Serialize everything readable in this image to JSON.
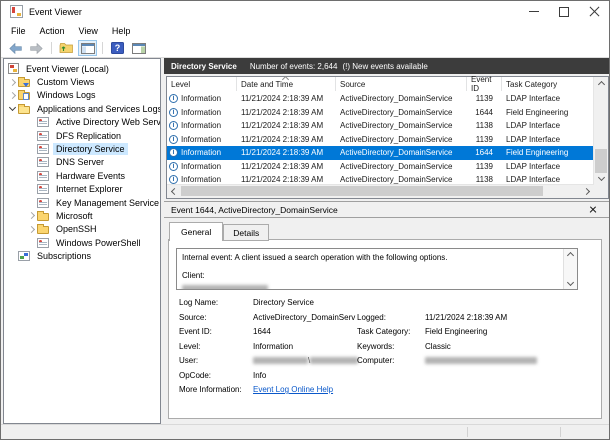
{
  "window": {
    "title": "Event Viewer"
  },
  "menu": {
    "items": [
      "File",
      "Action",
      "View",
      "Help"
    ]
  },
  "toolbar": {
    "icons": [
      "back-icon",
      "forward-icon",
      "up-one-level-icon",
      "show-hide-console-tree-icon",
      "help-icon",
      "show-hide-action-pane-icon"
    ]
  },
  "tree": {
    "items": [
      {
        "label": "Event Viewer (Local)",
        "level": 0,
        "icon": "event-viewer",
        "expander": ""
      },
      {
        "label": "Custom Views",
        "level": 1,
        "icon": "custom-views",
        "expander": ">"
      },
      {
        "label": "Windows Logs",
        "level": 1,
        "icon": "windows-logs",
        "expander": ">"
      },
      {
        "label": "Applications and Services Logs",
        "level": 1,
        "icon": "folder-open",
        "expander": "v"
      },
      {
        "label": "Active Directory Web Services",
        "level": 2,
        "icon": "event-log",
        "expander": ""
      },
      {
        "label": "DFS Replication",
        "level": 2,
        "icon": "event-log",
        "expander": ""
      },
      {
        "label": "Directory Service",
        "level": 2,
        "icon": "event-log",
        "expander": "",
        "selected": true
      },
      {
        "label": "DNS Server",
        "level": 2,
        "icon": "event-log",
        "expander": ""
      },
      {
        "label": "Hardware Events",
        "level": 2,
        "icon": "event-log",
        "expander": ""
      },
      {
        "label": "Internet Explorer",
        "level": 2,
        "icon": "event-log",
        "expander": ""
      },
      {
        "label": "Key Management Service",
        "level": 2,
        "icon": "event-log",
        "expander": ""
      },
      {
        "label": "Microsoft",
        "level": 2,
        "icon": "folder",
        "expander": ">"
      },
      {
        "label": "OpenSSH",
        "level": 2,
        "icon": "folder",
        "expander": ">"
      },
      {
        "label": "Windows PowerShell",
        "level": 2,
        "icon": "event-log",
        "expander": ""
      },
      {
        "label": "Subscriptions",
        "level": 1,
        "icon": "subscriptions",
        "expander": ""
      }
    ]
  },
  "header": {
    "title": "Directory Service",
    "count_text": "Number of events: 2,644",
    "new_events_text": "(!) New events available"
  },
  "events_table": {
    "columns": [
      "Level",
      "Date and Time",
      "Source",
      "Event ID",
      "Task Category"
    ],
    "sorted_column": "Date and Time",
    "rows": [
      {
        "level": "Information",
        "datetime": "11/21/2024 2:18:39 AM",
        "source": "ActiveDirectory_DomainService",
        "event_id": "1139",
        "task_category": "LDAP Interface"
      },
      {
        "level": "Information",
        "datetime": "11/21/2024 2:18:39 AM",
        "source": "ActiveDirectory_DomainService",
        "event_id": "1644",
        "task_category": "Field Engineering"
      },
      {
        "level": "Information",
        "datetime": "11/21/2024 2:18:39 AM",
        "source": "ActiveDirectory_DomainService",
        "event_id": "1138",
        "task_category": "LDAP Interface"
      },
      {
        "level": "Information",
        "datetime": "11/21/2024 2:18:39 AM",
        "source": "ActiveDirectory_DomainService",
        "event_id": "1139",
        "task_category": "LDAP Interface"
      },
      {
        "level": "Information",
        "datetime": "11/21/2024 2:18:39 AM",
        "source": "ActiveDirectory_DomainService",
        "event_id": "1644",
        "task_category": "Field Engineering",
        "selected": true
      },
      {
        "level": "Information",
        "datetime": "11/21/2024 2:18:39 AM",
        "source": "ActiveDirectory_DomainService",
        "event_id": "1139",
        "task_category": "LDAP Interface"
      },
      {
        "level": "Information",
        "datetime": "11/21/2024 2:18:39 AM",
        "source": "ActiveDirectory_DomainService",
        "event_id": "1138",
        "task_category": "LDAP Interface"
      }
    ]
  },
  "details": {
    "title": "Event 1644, ActiveDirectory_DomainService",
    "tabs": [
      {
        "label": "General",
        "active": true
      },
      {
        "label": "Details",
        "active": false
      }
    ],
    "message": {
      "line1": "Internal event: A client issued a search operation with the following options.",
      "line2": "Client:",
      "client_value_redacted": true
    },
    "fields_left": [
      {
        "label": "Log Name:",
        "value": "Directory Service"
      },
      {
        "label": "Source:",
        "value": "ActiveDirectory_DomainServ"
      },
      {
        "label": "Event ID:",
        "value": "1644"
      },
      {
        "label": "Level:",
        "value": "Information"
      },
      {
        "label": "User:",
        "redacted": "pair",
        "separator": "\\"
      },
      {
        "label": "OpCode:",
        "value": "Info"
      },
      {
        "label": "More Information:",
        "value": "Event Log Online Help",
        "link": true
      }
    ],
    "fields_right": [
      {
        "label": "Logged:",
        "value": "11/21/2024 2:18:39 AM"
      },
      {
        "label": "Task Category:",
        "value": "Field Engineering"
      },
      {
        "label": "Keywords:",
        "value": "Classic"
      },
      {
        "label": "Computer:",
        "redacted": "single"
      }
    ]
  },
  "colors": {
    "selected_row": "#0078d7",
    "tree_selection": "#cce8ff",
    "log_header_bar": "#3c3c3c",
    "link": "#0a58ca",
    "pane_background": "#f0f0f0"
  }
}
